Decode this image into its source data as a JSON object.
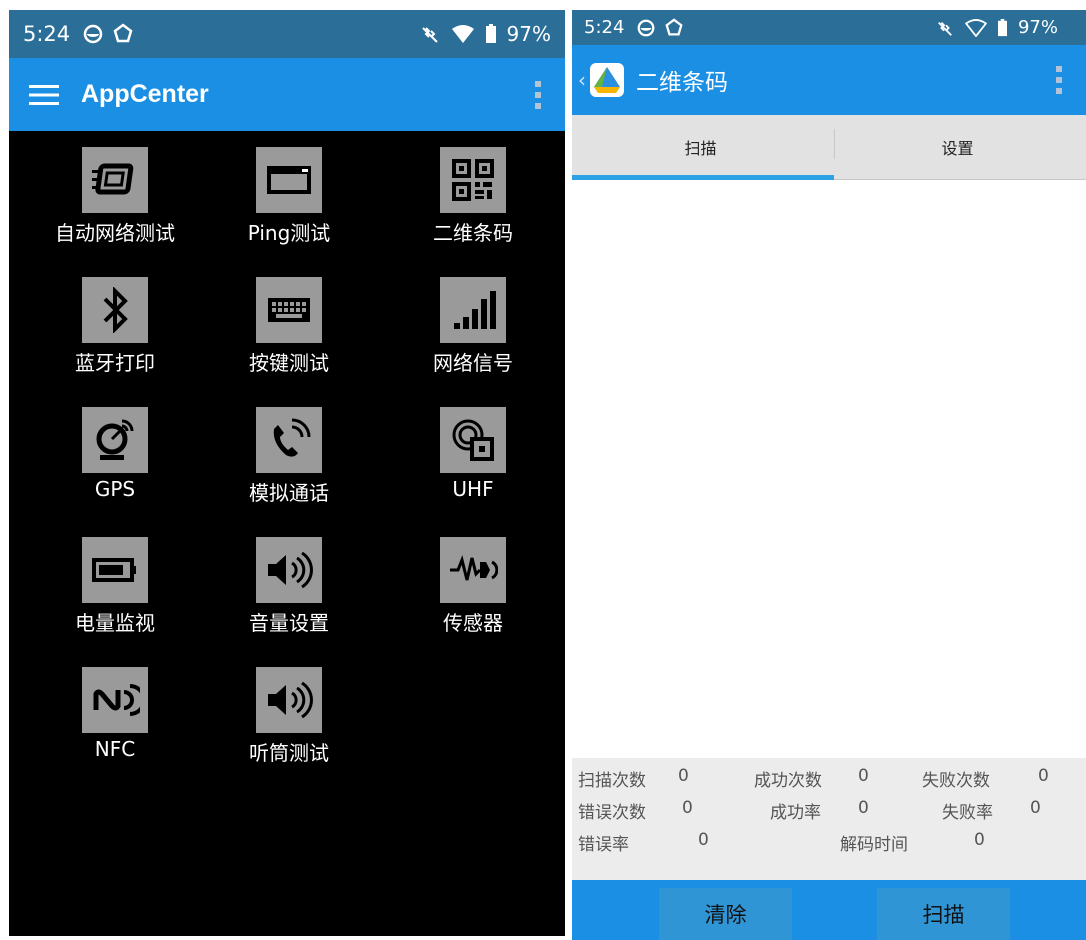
{
  "left": {
    "status": {
      "time": "5:24",
      "battery": "97%"
    },
    "appbar": {
      "title": "AppCenter"
    },
    "apps": [
      {
        "label": "自动网络测试",
        "icon": "network-test-icon"
      },
      {
        "label": "Ping测试",
        "icon": "ping-icon"
      },
      {
        "label": "二维条码",
        "icon": "qr-code-icon"
      },
      {
        "label": "蓝牙打印",
        "icon": "bluetooth-icon"
      },
      {
        "label": "按键测试",
        "icon": "keyboard-icon"
      },
      {
        "label": "网络信号",
        "icon": "signal-bars-icon"
      },
      {
        "label": "GPS",
        "icon": "satellite-dish-icon"
      },
      {
        "label": "模拟通话",
        "icon": "phone-call-icon"
      },
      {
        "label": "UHF",
        "icon": "uhf-icon"
      },
      {
        "label": "电量监视",
        "icon": "battery-icon"
      },
      {
        "label": "音量设置",
        "icon": "volume-icon"
      },
      {
        "label": "传感器",
        "icon": "sensor-icon"
      },
      {
        "label": "NFC",
        "icon": "nfc-icon"
      },
      {
        "label": "听筒测试",
        "icon": "earpiece-icon"
      }
    ]
  },
  "right": {
    "status": {
      "time": "5:24",
      "battery": "97%"
    },
    "appbar": {
      "title": "二维条码"
    },
    "tabs": [
      {
        "label": "扫描"
      },
      {
        "label": "设置"
      }
    ],
    "stats": {
      "scan_count_label": "扫描次数",
      "scan_count": "0",
      "success_count_label": "成功次数",
      "success_count": "0",
      "fail_count_label": "失败次数",
      "fail_count": "0",
      "error_count_label": "错误次数",
      "error_count": "0",
      "success_rate_label": "成功率",
      "success_rate": "0",
      "fail_rate_label": "失败率",
      "fail_rate": "0",
      "error_rate_label": "错误率",
      "error_rate": "0",
      "decode_time_label": "解码时间",
      "decode_time": "0"
    },
    "buttons": {
      "clear": "清除",
      "scan": "扫描"
    }
  },
  "colors": {
    "statusbar": "#2b6f99",
    "appbar": "#1a8fe4",
    "tab_indicator": "#2da3e6",
    "icon_bg": "#9a9a9a"
  }
}
